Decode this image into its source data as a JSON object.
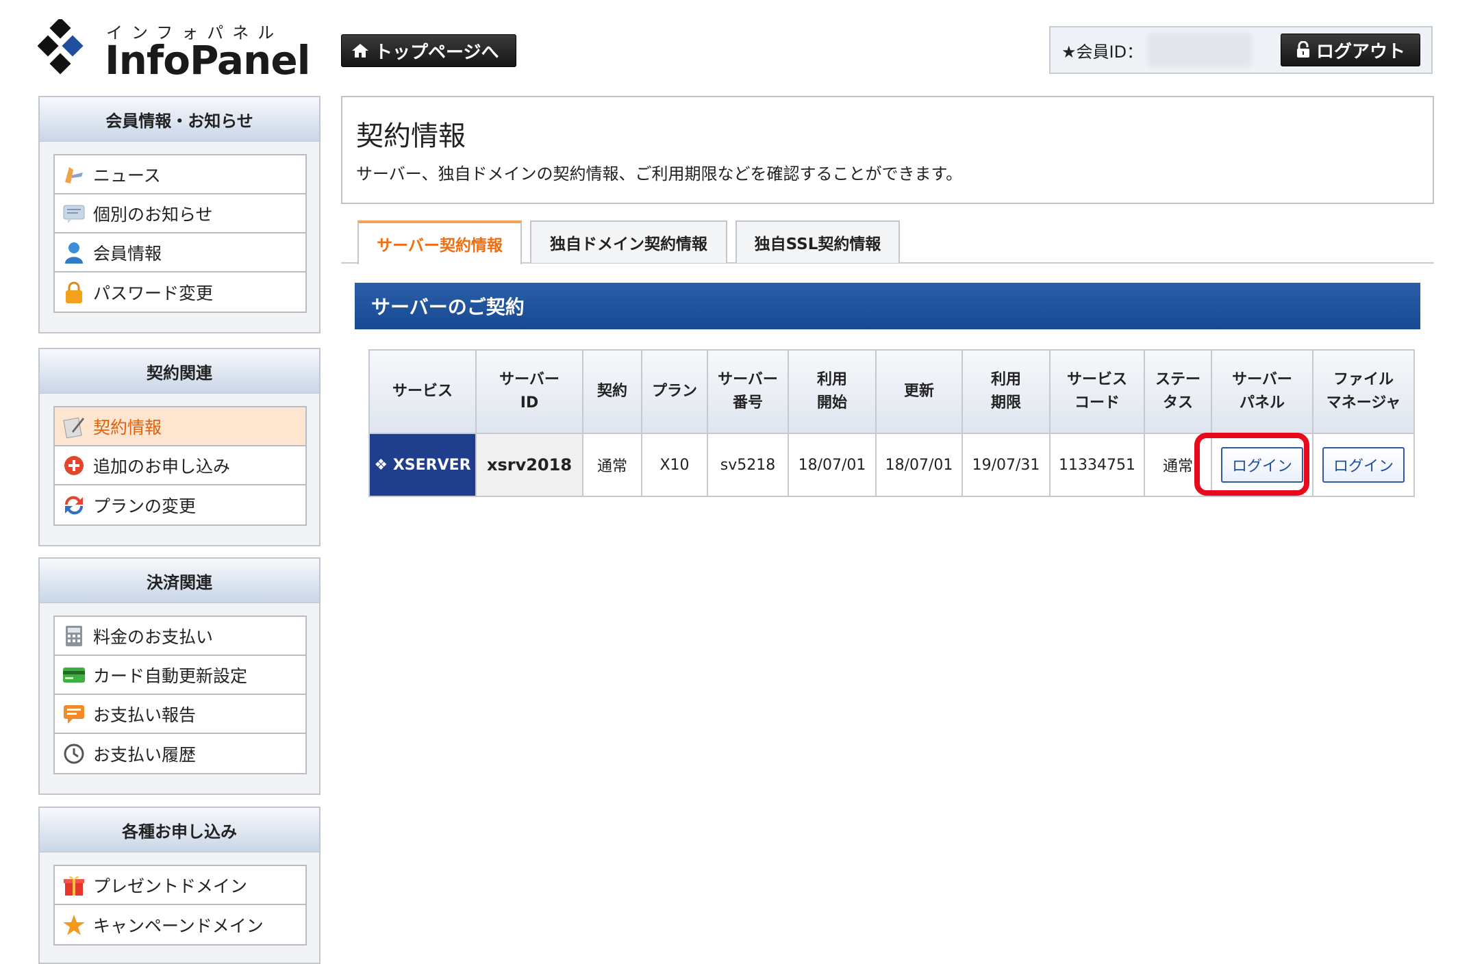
{
  "logo": {
    "kana": "インフォパネル",
    "name": "InfoPanel"
  },
  "header": {
    "top_button": "トップページへ",
    "member_label": "★会員ID：",
    "logout_button": "ログアウト"
  },
  "sidebar": [
    {
      "title": "会員情報・お知らせ",
      "items": [
        {
          "label": "ニュース",
          "icon": "news-icon"
        },
        {
          "label": "個別のお知らせ",
          "icon": "message-icon"
        },
        {
          "label": "会員情報",
          "icon": "user-icon"
        },
        {
          "label": "パスワード変更",
          "icon": "lock-icon"
        }
      ]
    },
    {
      "title": "契約関連",
      "items": [
        {
          "label": "契約情報",
          "icon": "contract-icon",
          "active": true
        },
        {
          "label": "追加のお申し込み",
          "icon": "plus-icon"
        },
        {
          "label": "プランの変更",
          "icon": "refresh-icon"
        }
      ]
    },
    {
      "title": "決済関連",
      "items": [
        {
          "label": "料金のお支払い",
          "icon": "calculator-icon"
        },
        {
          "label": "カード自動更新設定",
          "icon": "card-icon"
        },
        {
          "label": "お支払い報告",
          "icon": "report-icon"
        },
        {
          "label": "お支払い履歴",
          "icon": "clock-icon"
        }
      ]
    },
    {
      "title": "各種お申し込み",
      "items": [
        {
          "label": "プレゼントドメイン",
          "icon": "gift-icon"
        },
        {
          "label": "キャンペーンドメイン",
          "icon": "star-icon"
        }
      ]
    }
  ],
  "main": {
    "title": "契約情報",
    "description": "サーバー、独自ドメインの契約情報、ご利用期限などを確認することができます。",
    "tabs": [
      {
        "label": "サーバー契約情報",
        "active": true
      },
      {
        "label": "独自ドメイン契約情報"
      },
      {
        "label": "独自SSL契約情報"
      }
    ],
    "section_title": "サーバーのご契約",
    "table": {
      "headers": [
        "サービス",
        "サーバー\nID",
        "契約",
        "プラン",
        "サーバー\n番号",
        "利用\n開始",
        "更新",
        "利用\n期限",
        "サービス\nコード",
        "ステー\nタス",
        "サーバー\nパネル",
        "ファイル\nマネージャ"
      ],
      "row": {
        "service": "XSERVER",
        "server_id": "xsrv2018",
        "contract": "通常",
        "plan": "X10",
        "server_number": "sv5218",
        "start": "18/07/01",
        "renewal": "18/07/01",
        "expiry": "19/07/31",
        "service_code": "11334751",
        "status": "通常",
        "server_panel_button": "ログイン",
        "file_manager_button": "ログイン"
      }
    }
  },
  "colors": {
    "accent_orange": "#f06e12",
    "section_blue": "#1f4f97",
    "highlight_red": "#e8091d"
  }
}
